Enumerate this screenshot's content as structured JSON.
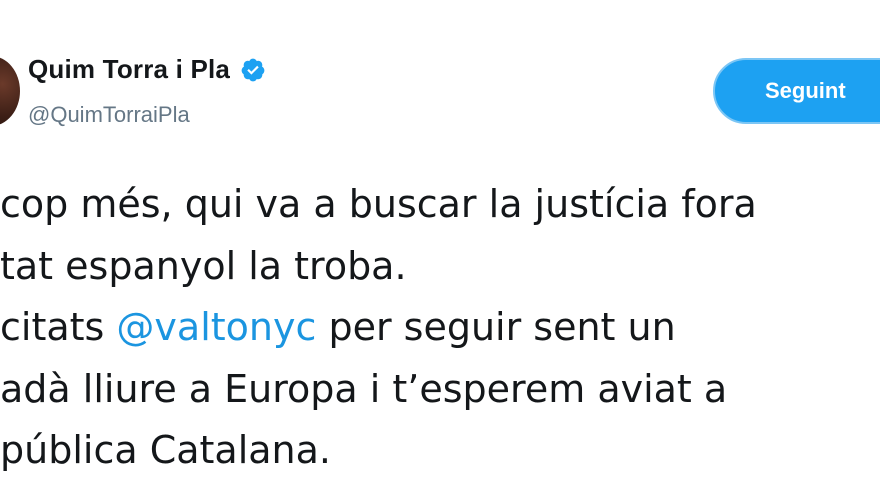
{
  "author": {
    "display_name": "Quim Torra i Pla",
    "handle": "@QuimTorraiPla",
    "verified": true,
    "verified_icon": "verified-badge-icon",
    "verified_color": "#1da1f2"
  },
  "follow_button": {
    "label": "Seguint",
    "background_color": "#1da1f2"
  },
  "tweet": {
    "line1": "cop més, qui va a buscar la justícia fora",
    "line2": "tat espanyol la troba.",
    "line3_before": "citats ",
    "line3_mention": "@valtonyc",
    "line3_after": " per seguir sent un",
    "line4": "adà lliure a Europa i t’esperem aviat a",
    "line5": "pública Catalana.",
    "mention_color": "#1b95e0"
  }
}
